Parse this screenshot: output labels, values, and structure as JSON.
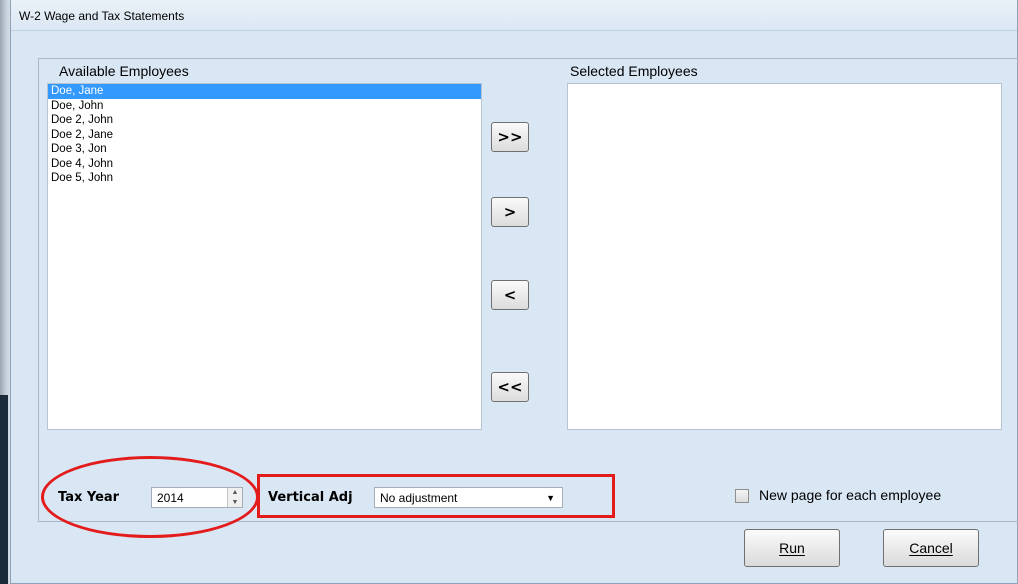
{
  "window": {
    "title": "W-2 Wage and Tax Statements"
  },
  "available": {
    "label": "Available Employees",
    "items": [
      "Doe, Jane",
      "Doe, John",
      "Doe 2, John",
      "Doe 2, Jane",
      "Doe 3, Jon",
      "Doe 4, John",
      "Doe 5, John"
    ],
    "selected_index": 0
  },
  "selected": {
    "label": "Selected Employees",
    "items": []
  },
  "buttons": {
    "add_all": ">>",
    "add_one": ">",
    "remove_one": "<",
    "remove_all": "<<",
    "run": "Run",
    "cancel": "Cancel"
  },
  "tax_year": {
    "label": "Tax Year",
    "value": "2014"
  },
  "vertical_adj": {
    "label": "Vertical Adj",
    "value": "No adjustment"
  },
  "new_page": {
    "label": "New page for each employee",
    "checked": false
  },
  "colors": {
    "annotation": "#e31b1b",
    "selection": "#3399ff",
    "dialog_bg": "#d9e6f3"
  }
}
